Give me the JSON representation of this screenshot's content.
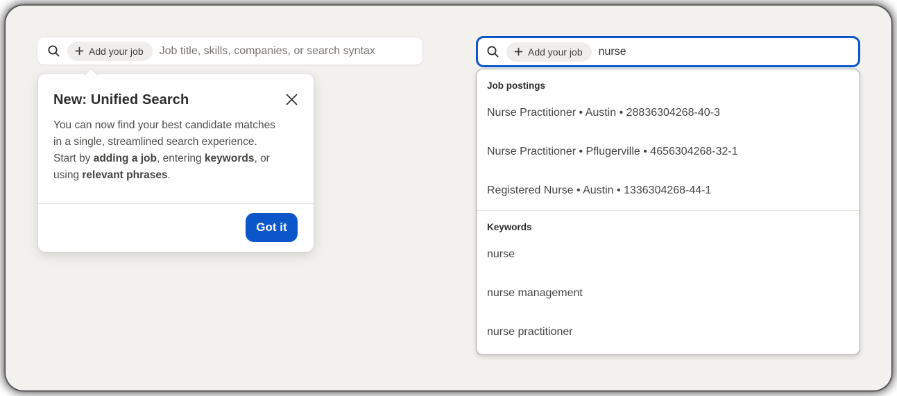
{
  "colors": {
    "canvas_bg": "#f2f1ee",
    "accent_blue": "#0b56c9",
    "chip_bg": "#f0eeec"
  },
  "left_search": {
    "chip_label": "Add your job",
    "placeholder": "Job title, skills, companies, or search syntax"
  },
  "tooltip": {
    "title": "New: Unified Search",
    "body_parts": [
      {
        "text": "You can now find your best candidate matches in a single, streamlined search experience. Start by "
      },
      {
        "text": "adding a job"
      },
      {
        "text": ", entering "
      },
      {
        "text": "keywords"
      },
      {
        "text": ", or using "
      },
      {
        "text": "relevant phrases"
      },
      {
        "text": "."
      }
    ],
    "got_it_label": "Got it"
  },
  "right_search": {
    "chip_label": "Add your job",
    "query": "nurse"
  },
  "dropdown": {
    "sections": [
      {
        "header": "Job postings",
        "items": [
          "Nurse Practitioner • Austin • 28836304268-40-3",
          "Nurse Practitioner • Pflugerville • 4656304268-32-1",
          "Registered Nurse • Austin • 1336304268-44-1"
        ]
      },
      {
        "header": "Keywords",
        "items": [
          "nurse",
          "nurse management",
          "nurse practitioner"
        ]
      }
    ]
  }
}
